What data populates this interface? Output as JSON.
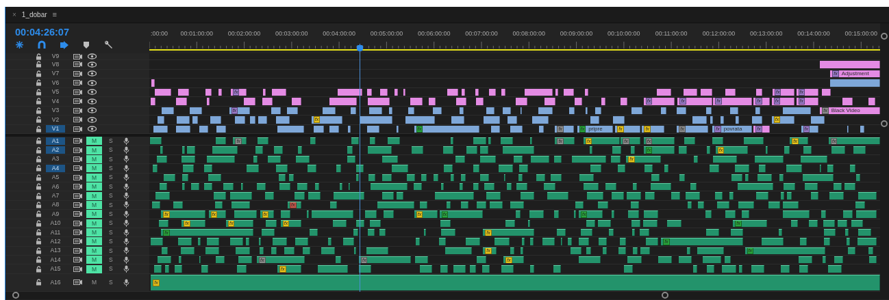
{
  "tab": {
    "close": "×",
    "title": "1_dobar",
    "menu": "≡"
  },
  "timecode": "00:04:26:07",
  "ruler": {
    "labels": [
      ":00:00",
      "00:01:00:00",
      "00:02:00:00",
      "00:03:00:00",
      "00:04:00:00",
      "00:05:00:00",
      "00:06:00:00",
      "00:07:00:00",
      "00:08:00:00",
      "00:09:00:00",
      "00:10:00:00",
      "00:11:00:00",
      "00:12:00:00",
      "00:13:00:00",
      "00:14:00:00",
      "00:15:00:00"
    ]
  },
  "tracks": [
    {
      "name": "V9",
      "kind": "video",
      "targeted": false
    },
    {
      "name": "V8",
      "kind": "video",
      "targeted": false,
      "clips": [
        {
          "color": "#e48be4"
        }
      ]
    },
    {
      "name": "V7",
      "kind": "video",
      "targeted": false,
      "clips": [
        {
          "color": "#e48be4",
          "badge": {
            "text": "fx",
            "color": "#9a79c9"
          },
          "label": "Adjustment"
        }
      ]
    },
    {
      "name": "V6",
      "kind": "video",
      "targeted": false,
      "clips": [
        {
          "color": "#e48be4"
        },
        {
          "color": "#7ea7d8"
        }
      ]
    },
    {
      "name": "V5",
      "kind": "video",
      "targeted": false,
      "clips": [
        {
          "color": "#e48be4",
          "badge": {
            "text": "fx",
            "color": "#9a79c9"
          }
        },
        {
          "color": "#e48be4",
          "badge": {
            "text": "fx",
            "color": "#9a79c9"
          }
        },
        {
          "color": "#e48be4",
          "badge": {
            "text": "fx",
            "color": "#9a79c9"
          }
        }
      ]
    },
    {
      "name": "V4",
      "kind": "video",
      "targeted": false,
      "clips": [
        {
          "color": "#e48be4",
          "badge": {
            "text": "fx",
            "color": "#9a79c9"
          }
        },
        {
          "color": "#e48be4",
          "badge": {
            "text": "fx",
            "color": "#9a79c9"
          }
        },
        {
          "color": "#e48be4",
          "badge": {
            "text": "fx",
            "color": "#9a79c9"
          }
        },
        {
          "color": "#e48be4",
          "badge": {
            "text": "fx",
            "color": "#9a79c9"
          }
        },
        {
          "color": "#e48be4",
          "badge": {
            "text": "fx",
            "color": "#9a79c9"
          }
        },
        {
          "color": "#e48be4",
          "badge": {
            "text": "fx",
            "color": "#9a79c9"
          }
        }
      ]
    },
    {
      "name": "V3",
      "kind": "video",
      "targeted": false,
      "clips": [
        {
          "color": "#7ea7d8",
          "badge": {
            "text": "fx",
            "color": "#9a79c9"
          }
        },
        {
          "color": "#e48be4",
          "badge": {
            "text": "fx",
            "color": "#8a8a8a"
          },
          "label": "Black Video"
        }
      ]
    },
    {
      "name": "V2",
      "kind": "video",
      "targeted": false,
      "clips": [
        {
          "color": "#7ea7d8",
          "badge": {
            "text": "fx",
            "color": "#e6c21a"
          }
        },
        {
          "color": "#7ea7d8",
          "badge": {
            "text": "fx",
            "color": "#e6c21a"
          }
        }
      ]
    },
    {
      "name": "V1",
      "kind": "video",
      "targeted": true,
      "clips": [
        {
          "color": "#7ea7d8",
          "badge": {
            "text": "fx",
            "color": "#27a33a"
          }
        },
        {
          "color": "#7ea7d8",
          "badge": {
            "text": "fx",
            "color": "#8a8a8a"
          }
        },
        {
          "color": "#7ea7d8",
          "badge": {
            "text": "fx",
            "color": "#27a33a"
          },
          "label": "pripre"
        },
        {
          "color": "#7ea7d8",
          "badge": {
            "text": "fx",
            "color": "#e6c21a"
          }
        },
        {
          "color": "#7ea7d8",
          "badge": {
            "text": "fx",
            "color": "#e6c21a"
          }
        },
        {
          "color": "#7ea7d8",
          "badge": {
            "text": "fx",
            "color": "#8a8a8a"
          }
        },
        {
          "color": "#7ea7d8",
          "badge": {
            "text": "fx",
            "color": "#9a79c9"
          },
          "label": "povrata"
        },
        {
          "color": "#e48be4",
          "badge": {
            "text": "fx",
            "color": "#9a79c9"
          }
        },
        {
          "color": "#7ea7d8",
          "badge": {
            "text": "fx",
            "color": "#9a79c9"
          }
        }
      ]
    },
    {
      "name": "A1",
      "kind": "audio",
      "targeted": true,
      "mute_label": "M",
      "muted": true,
      "solo_label": "S",
      "clips": [
        {
          "badge": {
            "text": "fx",
            "color": "#8a8a8a"
          }
        },
        {
          "badge": {
            "text": "fx",
            "color": "#8a8a8a"
          }
        },
        {
          "badge": {
            "text": "fx",
            "color": "#e6c21a"
          }
        },
        {
          "badge": {
            "text": "fx",
            "color": "#8a8a8a"
          }
        },
        {
          "badge": {
            "text": "fx",
            "color": "#8a8a8a"
          }
        },
        {
          "badge": {
            "text": "fx",
            "color": "#e6c21a"
          }
        },
        {
          "badge": {
            "text": "fx",
            "color": "#8a8a8a"
          }
        }
      ]
    },
    {
      "name": "A2",
      "kind": "audio",
      "targeted": true,
      "mute_label": "M",
      "muted": true,
      "solo_label": "S",
      "clips": [
        {
          "badge": {
            "text": "fx",
            "color": "#27a33a"
          }
        },
        {
          "badge": {
            "text": "fx",
            "color": "#e6c21a"
          }
        }
      ]
    },
    {
      "name": "A3",
      "kind": "audio",
      "targeted": false,
      "mute_label": "M",
      "muted": true,
      "solo_label": "S",
      "clips": [
        {
          "badge": {
            "text": "fx",
            "color": "#e6c21a"
          }
        }
      ]
    },
    {
      "name": "A4",
      "kind": "audio",
      "targeted": true,
      "mute_label": "M",
      "muted": true,
      "solo_label": "S"
    },
    {
      "name": "A5",
      "kind": "audio",
      "targeted": false,
      "mute_label": "M",
      "muted": true,
      "solo_label": "S"
    },
    {
      "name": "A6",
      "kind": "audio",
      "targeted": false,
      "mute_label": "M",
      "muted": true,
      "solo_label": "S"
    },
    {
      "name": "A7",
      "kind": "audio",
      "targeted": false,
      "mute_label": "M",
      "muted": true,
      "solo_label": "S"
    },
    {
      "name": "A8",
      "kind": "audio",
      "targeted": false,
      "mute_label": "M",
      "muted": true,
      "solo_label": "S",
      "clips": [
        {
          "badge": {
            "text": "fx",
            "color": "#c0564a"
          }
        }
      ]
    },
    {
      "name": "A9",
      "kind": "audio",
      "targeted": false,
      "mute_label": "M",
      "muted": true,
      "solo_label": "S",
      "clips": [
        {
          "badge": {
            "text": "fx",
            "color": "#e6c21a"
          }
        },
        {
          "badge": {
            "text": "fx",
            "color": "#e6c21a"
          }
        },
        {
          "badge": {
            "text": "fx",
            "color": "#e6c21a"
          }
        },
        {
          "badge": {
            "text": "fx",
            "color": "#e6c21a"
          }
        },
        {
          "badge": {
            "text": "fx",
            "color": "#27a33a"
          }
        },
        {
          "badge": {
            "text": "fx",
            "color": "#27a33a"
          }
        }
      ]
    },
    {
      "name": "A10",
      "kind": "audio",
      "targeted": false,
      "mute_label": "M",
      "muted": true,
      "solo_label": "S",
      "clips": [
        {
          "badge": {
            "text": "fx",
            "color": "#e6c21a"
          }
        },
        {
          "badge": {
            "text": "fx",
            "color": "#e6c21a"
          }
        },
        {
          "badge": {
            "text": "fx",
            "color": "#e6c21a"
          }
        },
        {
          "badge": {
            "text": "fx",
            "color": "#27a33a"
          }
        }
      ]
    },
    {
      "name": "A11",
      "kind": "audio",
      "targeted": false,
      "mute_label": "M",
      "muted": true,
      "solo_label": "S",
      "clips": [
        {
          "badge": {
            "text": "fx",
            "color": "#27a33a"
          }
        },
        {
          "badge": {
            "text": "fx",
            "color": "#e6c21a"
          }
        }
      ]
    },
    {
      "name": "A12",
      "kind": "audio",
      "targeted": false,
      "mute_label": "M",
      "muted": true,
      "solo_label": "S",
      "clips": [
        {
          "badge": {
            "text": "fx",
            "color": "#27a33a"
          }
        }
      ]
    },
    {
      "name": "A13",
      "kind": "audio",
      "targeted": false,
      "mute_label": "M",
      "muted": true,
      "solo_label": "S",
      "clips": [
        {
          "badge": {
            "text": "fx",
            "color": "#e6c21a"
          }
        },
        {
          "badge": {
            "text": "fx",
            "color": "#27a33a"
          }
        }
      ]
    },
    {
      "name": "A14",
      "kind": "audio",
      "targeted": false,
      "mute_label": "M",
      "muted": true,
      "solo_label": "S",
      "clips": [
        {
          "badge": {
            "text": "fx",
            "color": "#8a8a8a"
          }
        },
        {
          "badge": {
            "text": "fx",
            "color": "#8a8a8a"
          }
        },
        {
          "badge": {
            "text": "fx",
            "color": "#e6c21a"
          }
        }
      ]
    },
    {
      "name": "A15",
      "kind": "audio",
      "targeted": false,
      "mute_label": "M",
      "muted": true,
      "solo_label": "S",
      "clips": [
        {
          "badge": {
            "text": "fx",
            "color": "#e6c21a"
          }
        }
      ]
    },
    {
      "name": "A16",
      "kind": "audio",
      "targeted": false,
      "mute_label": "M",
      "muted": false,
      "solo_label": "S",
      "clips": [
        {
          "badge": {
            "text": "fx",
            "color": "#e6c21a"
          }
        }
      ]
    }
  ]
}
